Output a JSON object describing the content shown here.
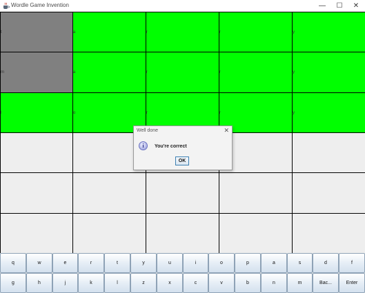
{
  "window": {
    "title": "Wordle Game Invention",
    "icon": "java-cup-icon",
    "controls": {
      "minimize": "—",
      "maximize": "☐",
      "close": "✕"
    }
  },
  "colors": {
    "correct": "#00ff00",
    "absent": "#808080",
    "empty": "#eeeeee",
    "grid_line": "#000000"
  },
  "grid": {
    "rows": [
      [
        {
          "letter": "t",
          "state": "absent"
        },
        {
          "letter": "a",
          "state": "correct"
        },
        {
          "letter": "r",
          "state": "correct"
        },
        {
          "letter": "r",
          "state": "correct"
        },
        {
          "letter": "y",
          "state": "correct"
        }
      ],
      [
        {
          "letter": "m",
          "state": "absent"
        },
        {
          "letter": "a",
          "state": "correct"
        },
        {
          "letter": "r",
          "state": "correct"
        },
        {
          "letter": "r",
          "state": "correct"
        },
        {
          "letter": "y",
          "state": "correct"
        }
      ],
      [
        {
          "letter": "l",
          "state": "correct"
        },
        {
          "letter": "o",
          "state": "correct"
        },
        {
          "letter": "r",
          "state": "correct"
        },
        {
          "letter": "r",
          "state": "correct"
        },
        {
          "letter": "y",
          "state": "correct"
        }
      ],
      [
        {
          "letter": "",
          "state": "empty"
        },
        {
          "letter": "",
          "state": "empty"
        },
        {
          "letter": "",
          "state": "empty"
        },
        {
          "letter": "",
          "state": "empty"
        },
        {
          "letter": "",
          "state": "empty"
        }
      ],
      [
        {
          "letter": "",
          "state": "empty"
        },
        {
          "letter": "",
          "state": "empty"
        },
        {
          "letter": "",
          "state": "empty"
        },
        {
          "letter": "",
          "state": "empty"
        },
        {
          "letter": "",
          "state": "empty"
        }
      ],
      [
        {
          "letter": "",
          "state": "empty"
        },
        {
          "letter": "",
          "state": "empty"
        },
        {
          "letter": "",
          "state": "empty"
        },
        {
          "letter": "",
          "state": "empty"
        },
        {
          "letter": "",
          "state": "empty"
        }
      ]
    ]
  },
  "keyboard": {
    "rows": [
      [
        "q",
        "w",
        "e",
        "r",
        "t",
        "y",
        "u",
        "i",
        "o",
        "p",
        "a",
        "s",
        "d",
        "f"
      ],
      [
        "g",
        "h",
        "j",
        "k",
        "l",
        "z",
        "x",
        "c",
        "v",
        "b",
        "n",
        "m",
        "Bac...",
        "Enter"
      ]
    ]
  },
  "dialog": {
    "title": "Well done",
    "message": "You're correct",
    "ok_label": "OK",
    "close_glyph": "✕",
    "icon": "info-icon",
    "icon_glyph": "i"
  }
}
